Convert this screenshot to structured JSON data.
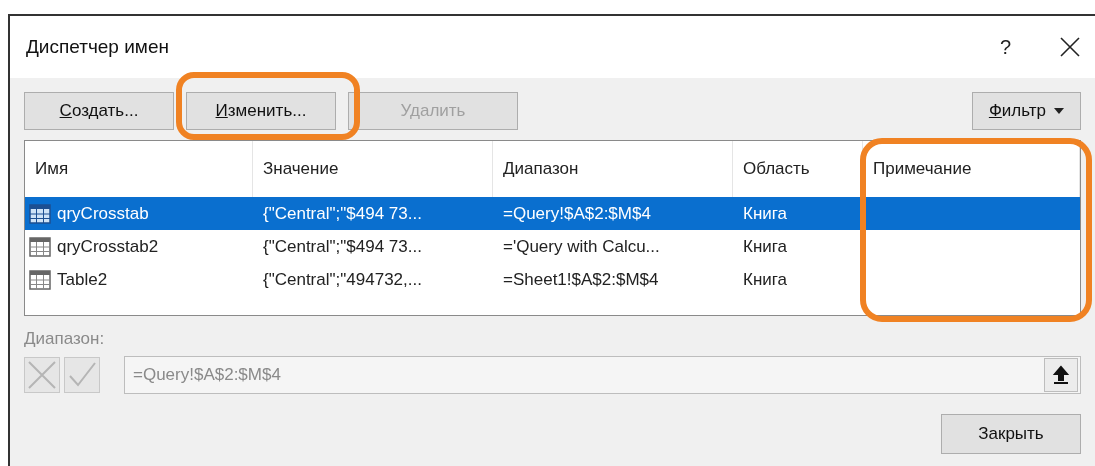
{
  "window": {
    "title": "Диспетчер имен",
    "help": "?"
  },
  "toolbar": [
    {
      "kind": "button",
      "accel": "С",
      "rest": "оздать...",
      "disabled": false
    },
    {
      "kind": "button",
      "accel": "И",
      "rest": "зменить...",
      "disabled": false
    },
    {
      "kind": "button",
      "rest": "Удалить",
      "disabled": true
    },
    {
      "kind": "dropdown",
      "accel": "Ф",
      "rest": "ильтр",
      "disabled": false
    }
  ],
  "table": {
    "columns": [
      "Имя",
      "Значение",
      "Диапазон",
      "Область",
      "Примечание"
    ],
    "rows": [
      {
        "selected": true,
        "cells": [
          "qryCrosstab",
          "{\"Central\";\"$494 73...",
          "=Query!$A$2:$M$4",
          "Книга",
          ""
        ]
      },
      {
        "selected": false,
        "cells": [
          "qryCrosstab2",
          "{\"Central\";\"$494 73...",
          "='Query with Calcu...",
          "Книга",
          ""
        ]
      },
      {
        "selected": false,
        "cells": [
          "Table2",
          "{\"Central\";\"494732,...",
          "=Sheet1!$A$2:$M$4",
          "Книга",
          ""
        ]
      }
    ]
  },
  "range": {
    "label": "Диапазон:",
    "value": "=Query!$A$2:$M$4"
  },
  "close_button": "Закрыть"
}
